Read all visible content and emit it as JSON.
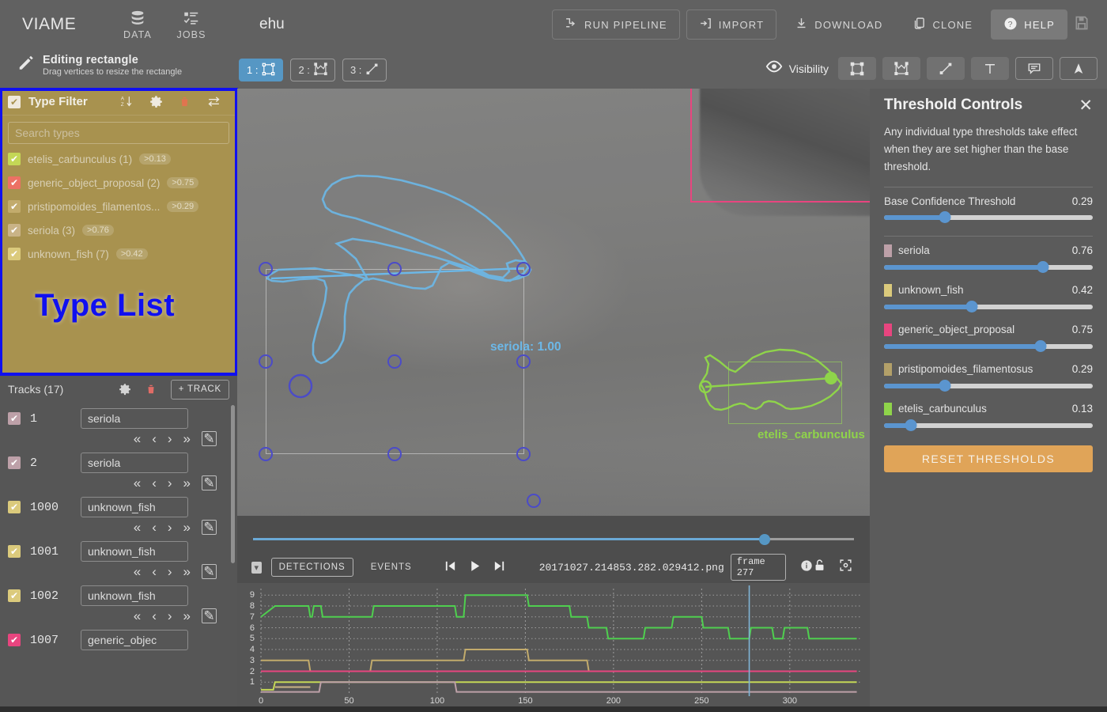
{
  "app": {
    "brand": "VIAME",
    "project_name": "ehu",
    "nav": [
      {
        "label": "DATA",
        "icon": "database-icon"
      },
      {
        "label": "JOBS",
        "icon": "tasklist-icon"
      }
    ],
    "actions": [
      {
        "label": "RUN PIPELINE",
        "icon": "pipeline-icon",
        "style": "outline"
      },
      {
        "label": "IMPORT",
        "icon": "import-icon",
        "style": "outline"
      },
      {
        "label": "DOWNLOAD",
        "icon": "download-icon",
        "style": "plain"
      },
      {
        "label": "CLONE",
        "icon": "clone-icon",
        "style": "plain"
      },
      {
        "label": "HELP",
        "icon": "help-icon",
        "style": "filled"
      }
    ],
    "save_icon": "save-icon"
  },
  "edit_state": {
    "title": "Editing rectangle",
    "subtitle": "Drag vertices to resize the rectangle",
    "icon": "pencil-icon"
  },
  "mode_buttons": [
    {
      "number": "1 :",
      "icon": "rectangle-icon",
      "active": true
    },
    {
      "number": "2 :",
      "icon": "polygon-icon",
      "active": false
    },
    {
      "number": "3 :",
      "icon": "line-icon",
      "active": false
    }
  ],
  "visibility": {
    "label": "Visibility",
    "eye_icon": "eye-icon",
    "buttons": [
      {
        "icon": "rectangle-icon",
        "filled": true
      },
      {
        "icon": "polygon-icon",
        "filled": true
      },
      {
        "icon": "line-icon",
        "filled": true
      },
      {
        "icon": "text-icon",
        "filled": true
      },
      {
        "icon": "tooltip-icon",
        "filled": false
      },
      {
        "icon": "cursor-icon",
        "filled": false
      }
    ]
  },
  "type_filter": {
    "title": "Type Filter",
    "header_icons": [
      "sort-alpha-icon",
      "gear-icon",
      "trash-icon",
      "swap-icon"
    ],
    "search_placeholder": "Search types",
    "search_value": "",
    "watermark": "Type List",
    "types": [
      {
        "name": "etelis_carbunculus (1)",
        "threshold": ">0.13",
        "color": "#c4d756"
      },
      {
        "name": "generic_object_proposal (2)",
        "threshold": ">0.75",
        "color": "#ec7164"
      },
      {
        "name": "pristipomoides_filamentos...",
        "threshold": ">0.29",
        "color": "#c2ab6c"
      },
      {
        "name": "seriola (3)",
        "threshold": ">0.76",
        "color": "#c9b387"
      },
      {
        "name": "unknown_fish (7)",
        "threshold": ">0.42",
        "color": "#dbca7c"
      }
    ]
  },
  "tracks": {
    "title": "Tracks (17)",
    "gear_icon": "gear-icon",
    "trash_icon": "trash-icon",
    "add_label": "+ TRACK",
    "nav_icons": [
      "«",
      "‹",
      "›",
      "»"
    ],
    "edit_icon": "edit-icon",
    "rows": [
      {
        "id": "1",
        "type": "seriola",
        "color": "#bda0a8"
      },
      {
        "id": "2",
        "type": "seriola",
        "color": "#bda0a8"
      },
      {
        "id": "1000",
        "type": "unknown_fish",
        "color": "#dbca7c"
      },
      {
        "id": "1001",
        "type": "unknown_fish",
        "color": "#dbca7c"
      },
      {
        "id": "1002",
        "type": "unknown_fish",
        "color": "#dbca7c"
      },
      {
        "id": "1007",
        "type": "generic_objec",
        "color": "#e8457f"
      }
    ]
  },
  "canvas": {
    "annotations": [
      {
        "label": "seriola: 1.00",
        "color": "#6cb8e8"
      },
      {
        "label": "etelis_carbunculus",
        "color": "#8fd44a"
      }
    ]
  },
  "player": {
    "detections_label": "DETECTIONS",
    "events_label": "EVENTS",
    "checkbox_icon": "chevron-down-icon",
    "prev_icon": "skip-previous-icon",
    "play_icon": "play-icon",
    "next_icon": "skip-next-icon",
    "filename": "20171027.214853.282.029412.png",
    "frame_label": "frame 277",
    "info_icon": "info-icon",
    "lock_icon": "unlock-icon",
    "fit_icon": "fit-to-screen-icon",
    "seek_percent": 85
  },
  "threshold_panel": {
    "title": "Threshold Controls",
    "close_icon": "close-icon",
    "description": "Any individual type thresholds take effect when they are set higher than the base threshold.",
    "base": {
      "label": "Base Confidence Threshold",
      "value": "0.29",
      "percent": 29
    },
    "types": [
      {
        "label": "seriola",
        "value": "0.76",
        "percent": 76,
        "color": "#bda0a8"
      },
      {
        "label": "unknown_fish",
        "value": "0.42",
        "percent": 42,
        "color": "#dbca7c"
      },
      {
        "label": "generic_object_proposal",
        "value": "0.75",
        "percent": 75,
        "color": "#e8457f"
      },
      {
        "label": "pristipomoides_filamentosus",
        "value": "0.29",
        "percent": 29,
        "color": "#b3a069"
      },
      {
        "label": "etelis_carbunculus",
        "value": "0.13",
        "percent": 13,
        "color": "#8fd44a"
      }
    ],
    "reset_label": "RESET THRESHOLDS"
  },
  "chart_data": {
    "type": "line",
    "title": "",
    "xlabel": "",
    "ylabel": "",
    "xlim": [
      0,
      340
    ],
    "ylim": [
      0,
      9.6
    ],
    "xticks": [
      0,
      50,
      100,
      150,
      200,
      250,
      300
    ],
    "yticks": [
      1,
      2,
      3,
      4,
      5,
      6,
      7,
      8,
      9
    ],
    "grid": true,
    "legend": "none",
    "playhead_x": 277,
    "series": [
      {
        "name": "unknown_fish",
        "color": "#4fcf4f",
        "points": [
          [
            0,
            7
          ],
          [
            8,
            8
          ],
          [
            27,
            8
          ],
          [
            28,
            7
          ],
          [
            29,
            7
          ],
          [
            30,
            8
          ],
          [
            34,
            8
          ],
          [
            35,
            7
          ],
          [
            63,
            7
          ],
          [
            64,
            8
          ],
          [
            110,
            8
          ],
          [
            111,
            7
          ],
          [
            115,
            7
          ],
          [
            116,
            9
          ],
          [
            151,
            9
          ],
          [
            152,
            8
          ],
          [
            175,
            8
          ],
          [
            176,
            7
          ],
          [
            185,
            7
          ],
          [
            186,
            6
          ],
          [
            196,
            6
          ],
          [
            197,
            5
          ],
          [
            217,
            5
          ],
          [
            218,
            6
          ],
          [
            233,
            6
          ],
          [
            234,
            7
          ],
          [
            250,
            7
          ],
          [
            251,
            6
          ],
          [
            265,
            6
          ],
          [
            266,
            5
          ],
          [
            277,
            5
          ],
          [
            278,
            6
          ],
          [
            290,
            6
          ],
          [
            291,
            5
          ],
          [
            296,
            5
          ],
          [
            297,
            6
          ],
          [
            310,
            6
          ],
          [
            311,
            5
          ],
          [
            338,
            5
          ]
        ]
      },
      {
        "name": "pristipomoides_filamentosus",
        "color": "#c2ab6c",
        "points": [
          [
            0,
            3
          ],
          [
            27,
            3
          ],
          [
            28,
            2
          ],
          [
            62,
            2
          ],
          [
            63,
            3
          ],
          [
            115,
            3
          ],
          [
            116,
            4
          ],
          [
            151,
            4
          ],
          [
            152,
            3
          ],
          [
            185,
            3
          ],
          [
            186,
            2
          ],
          [
            338,
            2
          ]
        ]
      },
      {
        "name": "generic_object_proposal",
        "color": "#e8457f",
        "points": [
          [
            0,
            2
          ],
          [
            338,
            2
          ]
        ]
      },
      {
        "name": "etelis_carbunculus",
        "color": "#c4d756",
        "points": [
          [
            0,
            0.3
          ],
          [
            7,
            0.3
          ],
          [
            8,
            1
          ],
          [
            338,
            1
          ]
        ]
      },
      {
        "name": "seriola",
        "color": "#bda0a8",
        "points": [
          [
            0,
            0.1
          ],
          [
            33,
            0.1
          ],
          [
            34,
            1
          ],
          [
            110,
            1
          ],
          [
            111,
            0.1
          ],
          [
            338,
            0.1
          ]
        ]
      },
      {
        "name": "track-segments",
        "color": "#c9b387",
        "points": [
          [
            8,
            0.55
          ],
          [
            27,
            0.55
          ],
          [
            28,
            0.55
          ]
        ]
      }
    ]
  }
}
